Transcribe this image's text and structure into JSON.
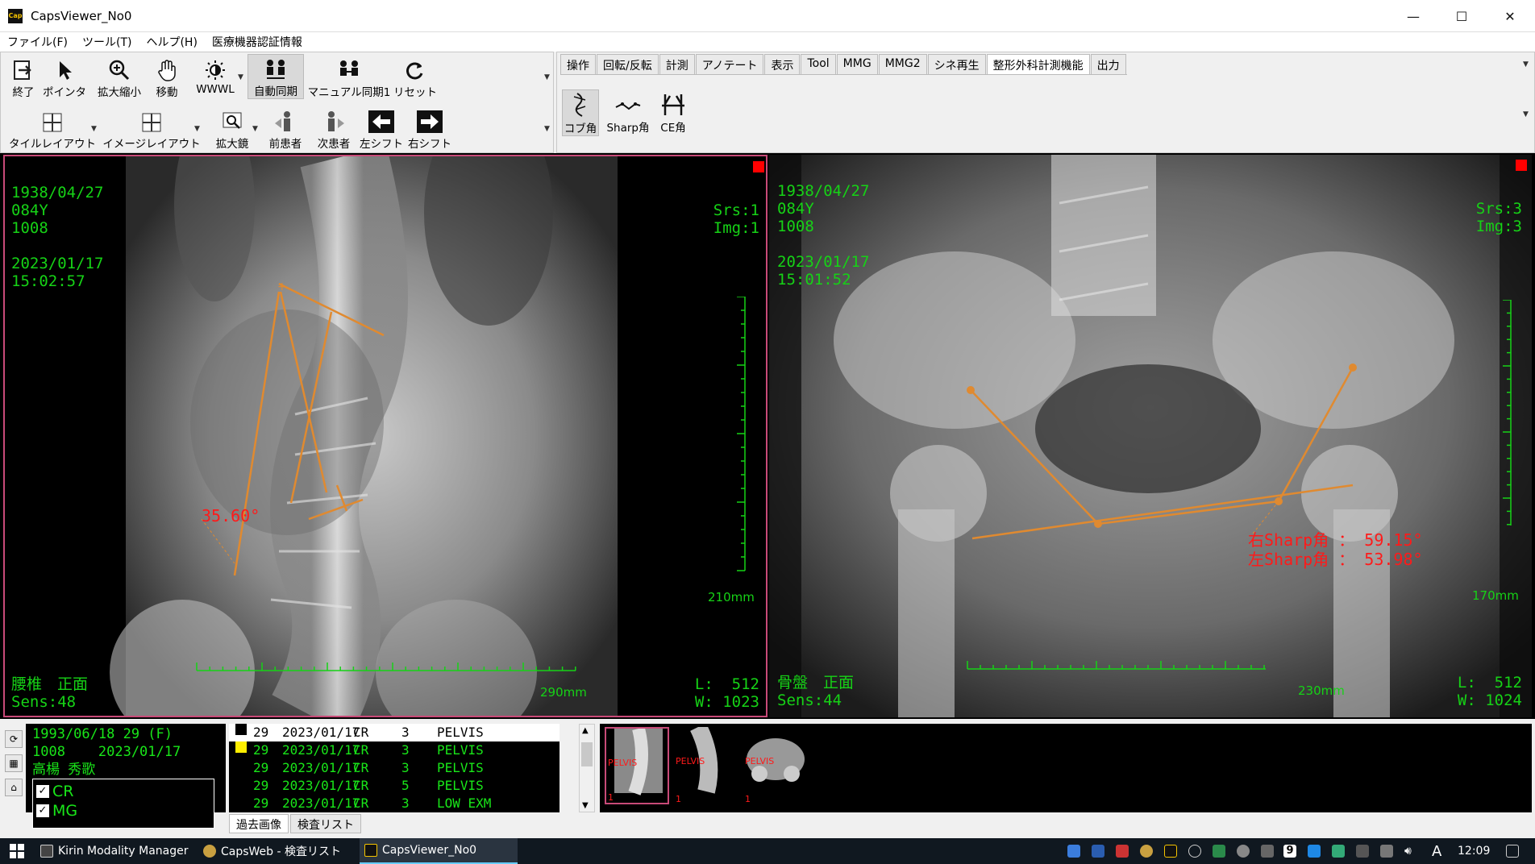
{
  "window": {
    "title": "CapsViewer_No0",
    "minimize": "—",
    "maximize": "☐",
    "close": "✕"
  },
  "menu": [
    "ファイル(F)",
    "ツール(T)",
    "ヘルプ(H)",
    "医療機器認証情報"
  ],
  "toolbar_left": {
    "row1": [
      {
        "label": "終了",
        "icon": "exit-icon"
      },
      {
        "label": "ポインタ",
        "icon": "pointer-icon"
      },
      {
        "label": "拡大縮小",
        "icon": "zoom-icon"
      },
      {
        "label": "移動",
        "icon": "hand-icon"
      },
      {
        "label": "WWWL",
        "icon": "brightness-icon"
      },
      {
        "label": "自動同期",
        "icon": "auto-sync-icon",
        "active": true
      },
      {
        "label": "マニュアル同期1",
        "icon": "manual-sync-icon"
      },
      {
        "label": "リセット",
        "icon": "reset-icon"
      }
    ],
    "row2": [
      {
        "label": "タイルレイアウト",
        "icon": "tile-layout-icon"
      },
      {
        "label": "イメージレイアウト",
        "icon": "image-layout-icon"
      },
      {
        "label": "拡大鏡",
        "icon": "magnifier-icon"
      },
      {
        "label": "前患者",
        "icon": "prev-patient-icon"
      },
      {
        "label": "次患者",
        "icon": "next-patient-icon"
      },
      {
        "label": "左シフト",
        "icon": "arrow-left-icon"
      },
      {
        "label": "右シフト",
        "icon": "arrow-right-icon"
      }
    ]
  },
  "toolbar_right": {
    "tabs": [
      "操作",
      "回転/反転",
      "計測",
      "アノテート",
      "表示",
      "Tool",
      "MMG",
      "MMG2",
      "シネ再生",
      "整形外科計測機能",
      "出力"
    ],
    "active_tab": "整形外科計測機能",
    "tools": [
      {
        "label": "コブ角",
        "icon": "cobb-angle-icon",
        "active": true
      },
      {
        "label": "Sharp角",
        "icon": "sharp-angle-icon"
      },
      {
        "label": "CE角",
        "icon": "ce-angle-icon"
      }
    ]
  },
  "viewports": {
    "left": {
      "birth_date": "1938/04/27",
      "age": "084Y",
      "patient_id": "1008",
      "study_date": "2023/01/17",
      "study_time": "15:02:57",
      "series": "Srs:1",
      "image": "Img:1",
      "scale_v": "210mm",
      "scale_h": "290mm",
      "body_part": "腰椎　正面",
      "sensitivity": "Sens:48",
      "level": "L:  512",
      "width": "W: 1023",
      "measurement": "35.60°"
    },
    "right": {
      "birth_date": "1938/04/27",
      "age": "084Y",
      "patient_id": "1008",
      "study_date": "2023/01/17",
      "study_time": "15:01:52",
      "series": "Srs:3",
      "image": "Img:3",
      "scale_v": "170mm",
      "scale_h": "230mm",
      "body_part": "骨盤　正面",
      "sensitivity": "Sens:44",
      "level": "L:  512",
      "width": "W: 1024",
      "measurement_right": "右Sharp角 ： 59.15°",
      "measurement_left": "左Sharp角 ： 53.98°"
    }
  },
  "patient": {
    "line1": "1993/06/18 29 (F)",
    "line2": "1008    2023/01/17",
    "name": "高楊 秀歌",
    "modalities": [
      "CR",
      "MG"
    ]
  },
  "studies": [
    {
      "n": "29",
      "date": "2023/01/17",
      "mod": "CR",
      "cnt": "3",
      "part": "PELVIS",
      "selected": true,
      "marker": "#000000"
    },
    {
      "n": "29",
      "date": "2023/01/17",
      "mod": "CR",
      "cnt": "3",
      "part": "PELVIS",
      "marker": "#ffee00"
    },
    {
      "n": "29",
      "date": "2023/01/17",
      "mod": "CR",
      "cnt": "3",
      "part": "PELVIS"
    },
    {
      "n": "29",
      "date": "2023/01/17",
      "mod": "CR",
      "cnt": "5",
      "part": "PELVIS"
    },
    {
      "n": "29",
      "date": "2023/01/17",
      "mod": "CR",
      "cnt": "3",
      "part": "LOW EXM"
    }
  ],
  "bottom_tabs": [
    "過去画像",
    "検査リスト"
  ],
  "thumbnails": [
    {
      "label": "PELVIS",
      "num": "1"
    },
    {
      "label": "PELVIS",
      "num": "1"
    },
    {
      "label": "PELVIS",
      "num": "1"
    }
  ],
  "taskbar": {
    "apps": [
      "Kirin Modality Manager",
      "CapsWeb - 検査リスト",
      "CapsViewer_No0"
    ],
    "badge": "9",
    "ime": "A",
    "time": "12:09"
  },
  "colors": {
    "overlay": "#16d216",
    "measure_line": "#e08a30",
    "measure_text": "#ff1a1a",
    "selection_border": "#c84a78"
  }
}
